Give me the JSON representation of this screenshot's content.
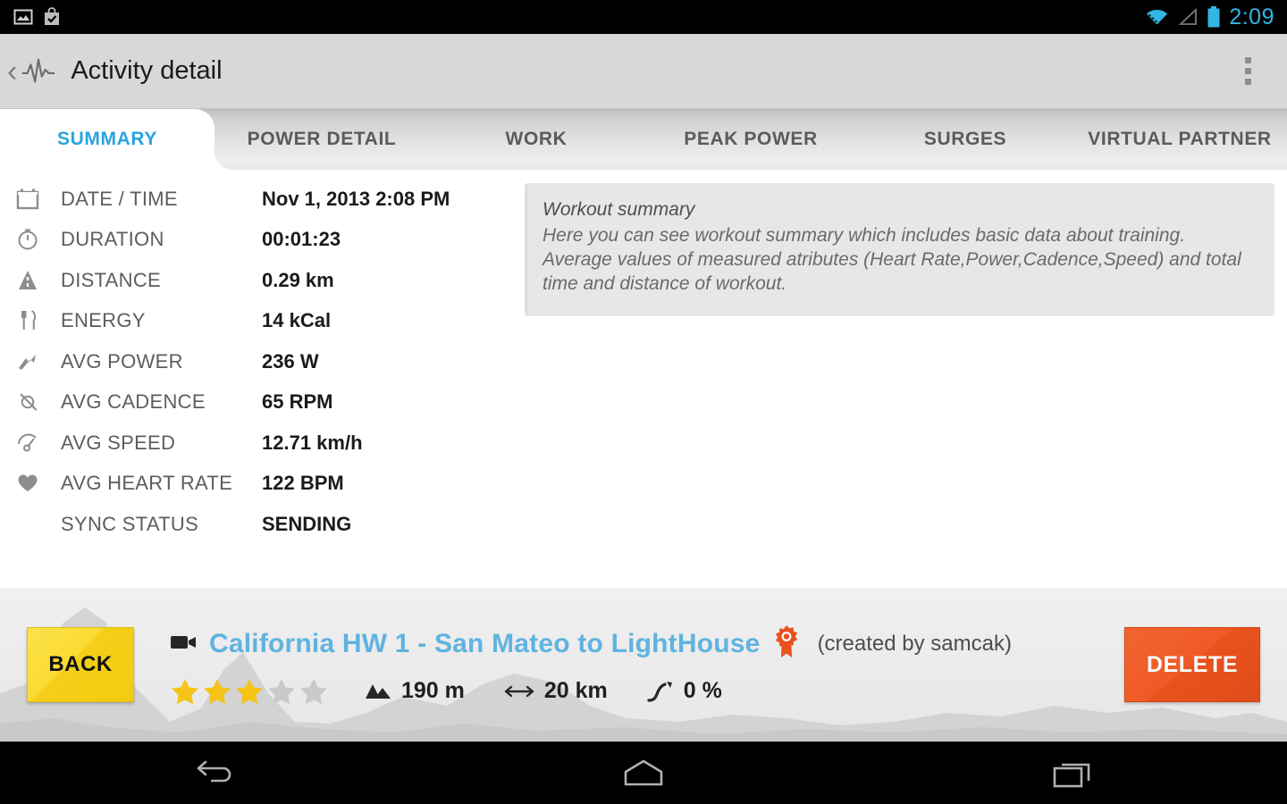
{
  "status_bar": {
    "time": "2:09",
    "left_icons": [
      "image-icon",
      "shopping-bag-check-icon"
    ],
    "right_icons": [
      "wifi-icon",
      "signal-icon",
      "battery-icon"
    ],
    "accent_color": "#33b5e5"
  },
  "action_bar": {
    "back_chevron": "‹",
    "app_icon": "activity-waveform-icon",
    "title": "Activity detail",
    "overflow": "overflow-menu-icon"
  },
  "tabs": [
    {
      "label": "SUMMARY",
      "active": true
    },
    {
      "label": "POWER DETAIL",
      "active": false
    },
    {
      "label": "WORK",
      "active": false
    },
    {
      "label": "PEAK POWER",
      "active": false
    },
    {
      "label": "SURGES",
      "active": false
    },
    {
      "label": "VIRTUAL PARTNER",
      "active": false
    }
  ],
  "metrics": [
    {
      "icon": "calendar-icon",
      "label": "DATE / TIME",
      "value": "Nov 1, 2013 2:08 PM"
    },
    {
      "icon": "stopwatch-icon",
      "label": "DURATION",
      "value": "00:01:23"
    },
    {
      "icon": "road-icon",
      "label": "DISTANCE",
      "value": "0.29 km"
    },
    {
      "icon": "cutlery-icon",
      "label": "ENERGY",
      "value": "14 kCal"
    },
    {
      "icon": "power-bolt-icon",
      "label": "AVG POWER",
      "value": "236 W"
    },
    {
      "icon": "cadence-icon",
      "label": "AVG CADENCE",
      "value": "65 RPM"
    },
    {
      "icon": "speedometer-icon",
      "label": "AVG SPEED",
      "value": "12.71 km/h"
    },
    {
      "icon": "heart-icon",
      "label": "AVG HEART RATE",
      "value": "122 BPM"
    },
    {
      "icon": "none",
      "label": "SYNC STATUS",
      "value": "SENDING"
    }
  ],
  "summary_card": {
    "title": "Workout summary",
    "body": "Here you can see workout summary which includes basic data about training. Average values of measured atributes (Heart Rate,Power,Cadence,Speed) and total time and distance of workout."
  },
  "track_bar": {
    "back_label": "BACK",
    "delete_label": "DELETE",
    "video_icon": "video-camera-icon",
    "track_name": "California HW 1 - San Mateo to LightHouse",
    "award_icon": "award-ribbon-icon",
    "author": "(created by samcak)",
    "rating": {
      "filled": 3,
      "total": 5
    },
    "stats": [
      {
        "icon": "mountain-icon",
        "value": "190 m"
      },
      {
        "icon": "horizontal-arrow-icon",
        "value": "20 km"
      },
      {
        "icon": "incline-arrow-icon",
        "value": "0 %"
      }
    ],
    "colors": {
      "track_link": "#5fb3e0",
      "back_button": "#f5cf17",
      "delete_button": "#e8521d",
      "star_filled": "#f5c417",
      "star_empty": "#c9c9c9"
    }
  },
  "nav_bar": {
    "buttons": [
      {
        "name": "back-nav-icon"
      },
      {
        "name": "home-nav-icon"
      },
      {
        "name": "recents-nav-icon"
      }
    ]
  }
}
